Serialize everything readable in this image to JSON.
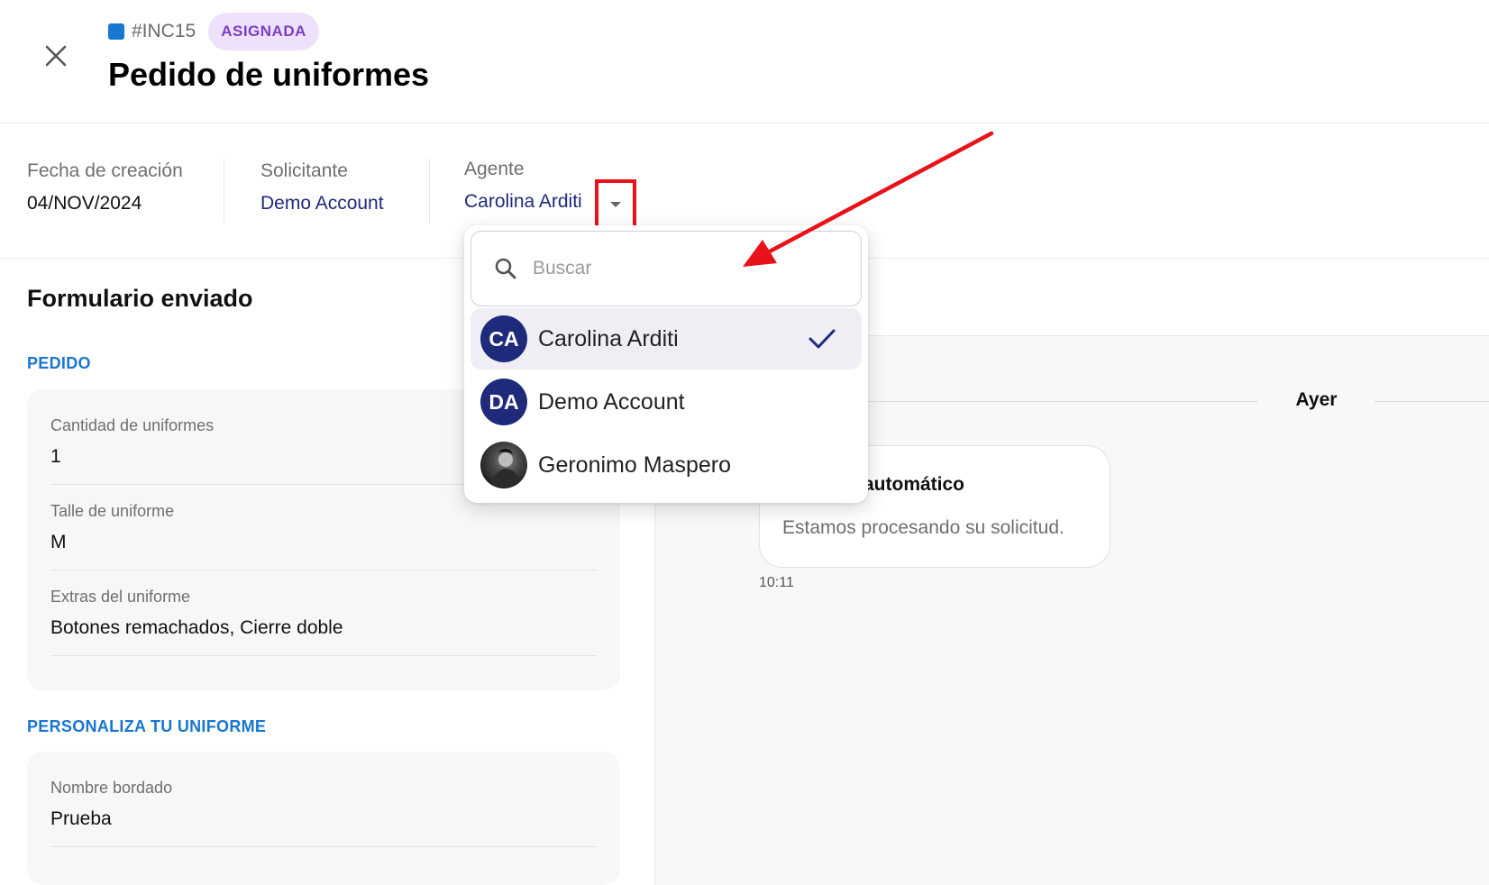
{
  "header": {
    "ticket_id": "#INC15",
    "status": "ASIGNADA",
    "title": "Pedido de uniformes",
    "ticket_color": "#1976d2"
  },
  "meta": {
    "creation_label": "Fecha de creación",
    "creation_value": "04/NOV/2024",
    "requester_label": "Solicitante",
    "requester_value": "Demo Account",
    "agent_label": "Agente",
    "agent_value": "Carolina Arditi"
  },
  "form": {
    "title": "Formulario enviado",
    "groups": [
      {
        "label": "PEDIDO",
        "fields": [
          {
            "label": "Cantidad de uniformes",
            "value": "1"
          },
          {
            "label": "Talle de uniforme",
            "value": "M"
          },
          {
            "label": "Extras del uniforme",
            "value": "Botones remachados, Cierre doble"
          }
        ]
      },
      {
        "label": "PERSONALIZA TU UNIFORME",
        "fields": [
          {
            "label": "Nombre bordado",
            "value": "Prueba"
          }
        ]
      }
    ]
  },
  "chat": {
    "day_label": "Ayer",
    "message_title": "automático",
    "message_text": "Estamos procesando su solicitud.",
    "message_time": "10:11"
  },
  "dropdown": {
    "search_placeholder": "Buscar",
    "options": [
      {
        "initials": "CA",
        "name": "Carolina Arditi",
        "selected": true
      },
      {
        "initials": "DA",
        "name": "Demo Account",
        "selected": false
      },
      {
        "initials": "",
        "name": "Geronimo Maspero",
        "selected": false
      }
    ]
  },
  "colors": {
    "accent": "#1976d2",
    "avatar": "#1f2a7a",
    "badge_bg": "#eee1fb",
    "badge_text": "#7b3fc4",
    "annotation": "#e8121a"
  }
}
